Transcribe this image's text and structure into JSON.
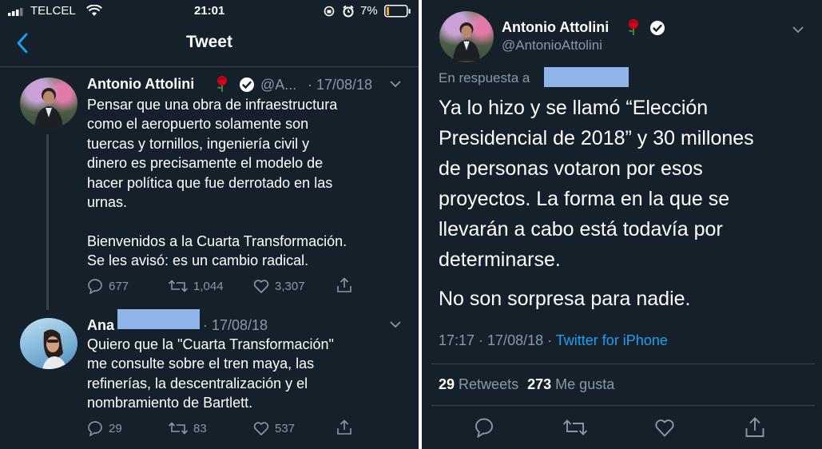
{
  "left": {
    "status_bar": {
      "carrier": "TELCEL",
      "time": "21:01",
      "battery": "7%"
    },
    "nav": {
      "title": "Tweet"
    },
    "tweets": [
      {
        "author_name": "Antonio Attolini",
        "handle": "@A...",
        "date": "· 17/08/18",
        "text": "Pensar que una obra de infraestructura\ncomo el aeropuerto solamente son\ntuercas y tornillos, ingeniería civil y\ndinero es precisamente el modelo de\nhacer política que fue derrotado en las\nurnas.\n\nBienvenidos a la Cuarta Transformación.\nSe les avisó: es un cambio radical.",
        "replies": "677",
        "retweets": "1,044",
        "likes": "3,307"
      },
      {
        "author_name": "Ana",
        "date": "· 17/08/18",
        "text": "Quiero que la \"Cuarta Transformación\"\nme consulte sobre el tren maya, las\nrefinerías, la descentralización y el\nnombramiento de Bartlett.",
        "replies": "29",
        "retweets": "83",
        "likes": "537"
      }
    ]
  },
  "right": {
    "author_name": "Antonio Attolini",
    "handle": "@AntonioAttolini",
    "reply_label": "En respuesta a",
    "text_p1": "Ya lo hizo y se llamó “Elección\nPresidencial de 2018” y 30 millones\nde personas votaron por esos\nproyectos. La forma en la que se\nllevarán a cabo está todavía por\ndeterminarse.",
    "text_p2": "No son sorpresa para nadie.",
    "time": "17:17 · 17/08/18 ·",
    "source": "Twitter for iPhone",
    "retweets_count": "29",
    "retweets_label": "Retweets",
    "likes_count": "273",
    "likes_label": "Me gusta"
  },
  "colors": {
    "background": "#15202b",
    "accent": "#1da1f2",
    "secondary_text": "#8899a6",
    "divider": "#38444d"
  }
}
